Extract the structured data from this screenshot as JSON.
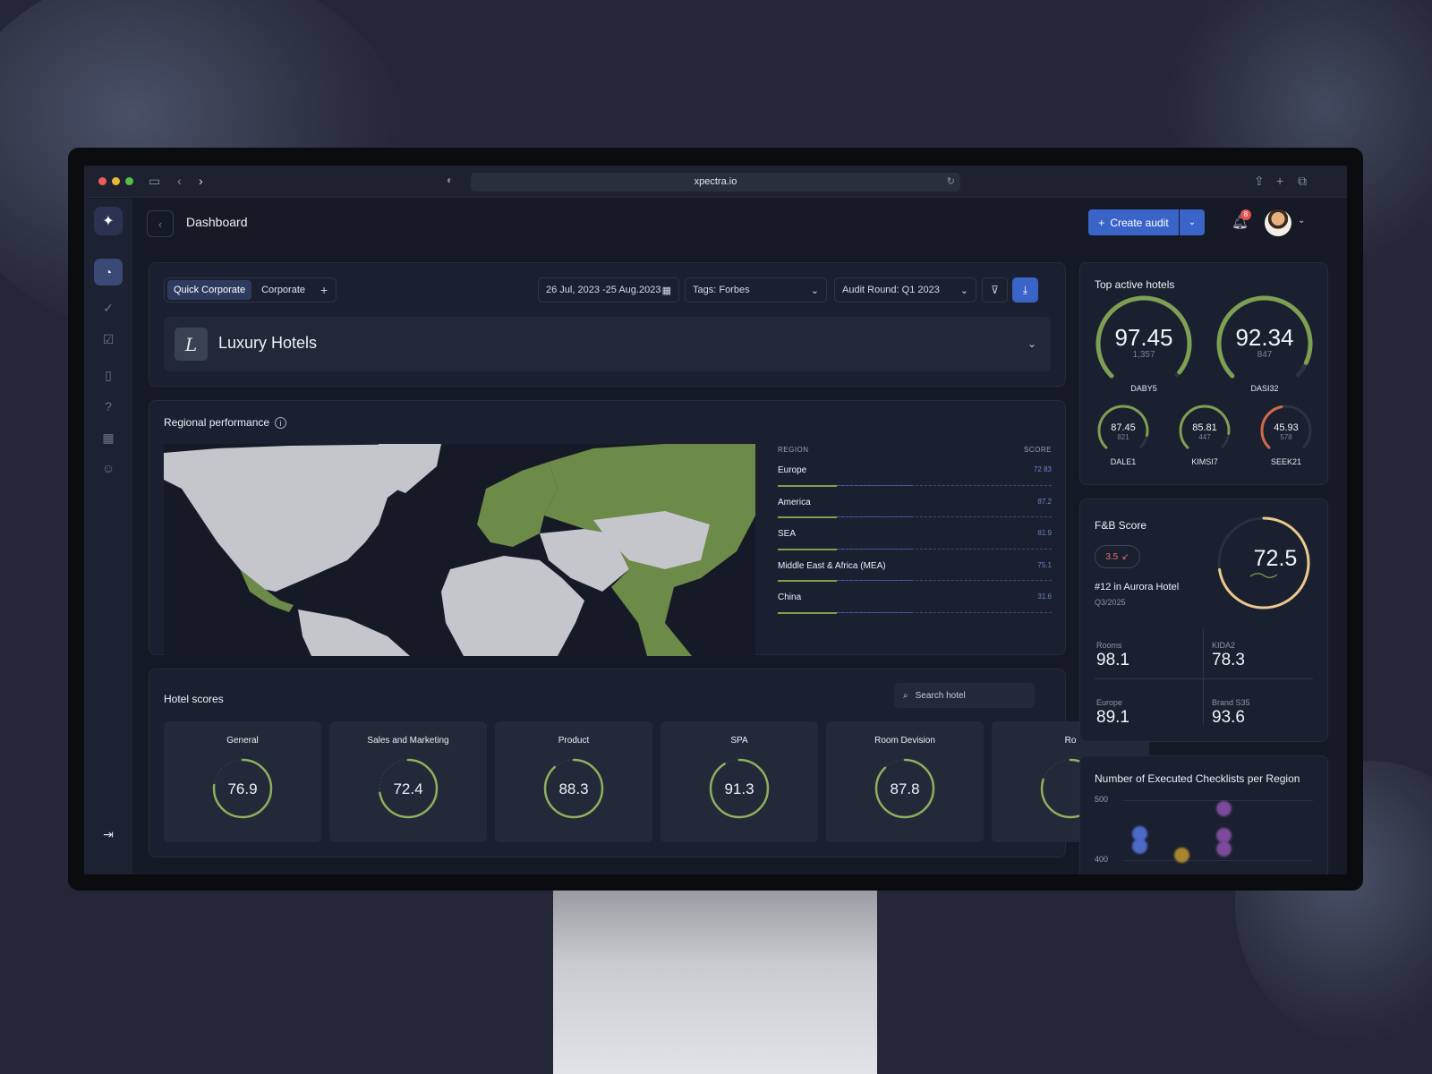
{
  "browser": {
    "url": "xpectra.io"
  },
  "header": {
    "title": "Dashboard",
    "create_label": "Create audit",
    "notifications": "8"
  },
  "filters": {
    "tabs": [
      "Quick Corporate",
      "Corporate"
    ],
    "date_range": "26 Jul, 2023 -25 Aug.2023",
    "tags": "Tags: Forbes",
    "audit_round": "Audit Round: Q1 2023",
    "brand": "Luxury Hotels"
  },
  "regional": {
    "title": "Regional performance",
    "col_region": "REGION",
    "col_score": "SCORE",
    "rows": [
      {
        "name": "Europe",
        "score": "72  83"
      },
      {
        "name": "America",
        "score": "87.2"
      },
      {
        "name": "SEA",
        "score": "81.9"
      },
      {
        "name": "Middle East & Africa (MEA)",
        "score": "75.1"
      },
      {
        "name": "China",
        "score": "31.6"
      }
    ]
  },
  "hotel_scores": {
    "title": "Hotel scores",
    "search_placeholder": "Search hotel",
    "tiles": [
      {
        "label": "General",
        "value": "76.9",
        "fraction": 0.769
      },
      {
        "label": "Sales and Marketing",
        "value": "72.4",
        "fraction": 0.724
      },
      {
        "label": "Product",
        "value": "88.3",
        "fraction": 0.883
      },
      {
        "label": "SPA",
        "value": "91.3",
        "fraction": 0.913
      },
      {
        "label": "Room Devision",
        "value": "87.8",
        "fraction": 0.878
      },
      {
        "label": "Ro",
        "value": "",
        "fraction": 0.8
      }
    ]
  },
  "top_hotels": {
    "title": "Top active hotels",
    "large": [
      {
        "value": "97.45",
        "sub": "1,357",
        "name": "DABY5",
        "color": "#7da052"
      },
      {
        "value": "92.34",
        "sub": "847",
        "name": "DASI32",
        "color": "#7da052"
      }
    ],
    "small": [
      {
        "value": "87.45",
        "sub": "821",
        "name": "DALE1",
        "color": "#7da052"
      },
      {
        "value": "85.81",
        "sub": "447",
        "name": "KIMSI7",
        "color": "#7da052"
      },
      {
        "value": "45.93",
        "sub": "578",
        "name": "SEEK21",
        "color": "#d26a4a"
      }
    ]
  },
  "fb": {
    "title": "F&B Score",
    "change": "3.5",
    "rank": "#12 in Aurora Hotel",
    "period": "Q3/2025",
    "score": "72.5",
    "stats": [
      {
        "label": "Rooms",
        "value": "98.1"
      },
      {
        "label": "KIDA2",
        "value": "78.3"
      },
      {
        "label": "Europe",
        "value": "89.1"
      },
      {
        "label": "Brand S35",
        "value": "93.6"
      }
    ]
  },
  "checklists": {
    "title": "Number of Executed Checklists per Region",
    "y_ticks": [
      "500",
      "400"
    ]
  }
}
